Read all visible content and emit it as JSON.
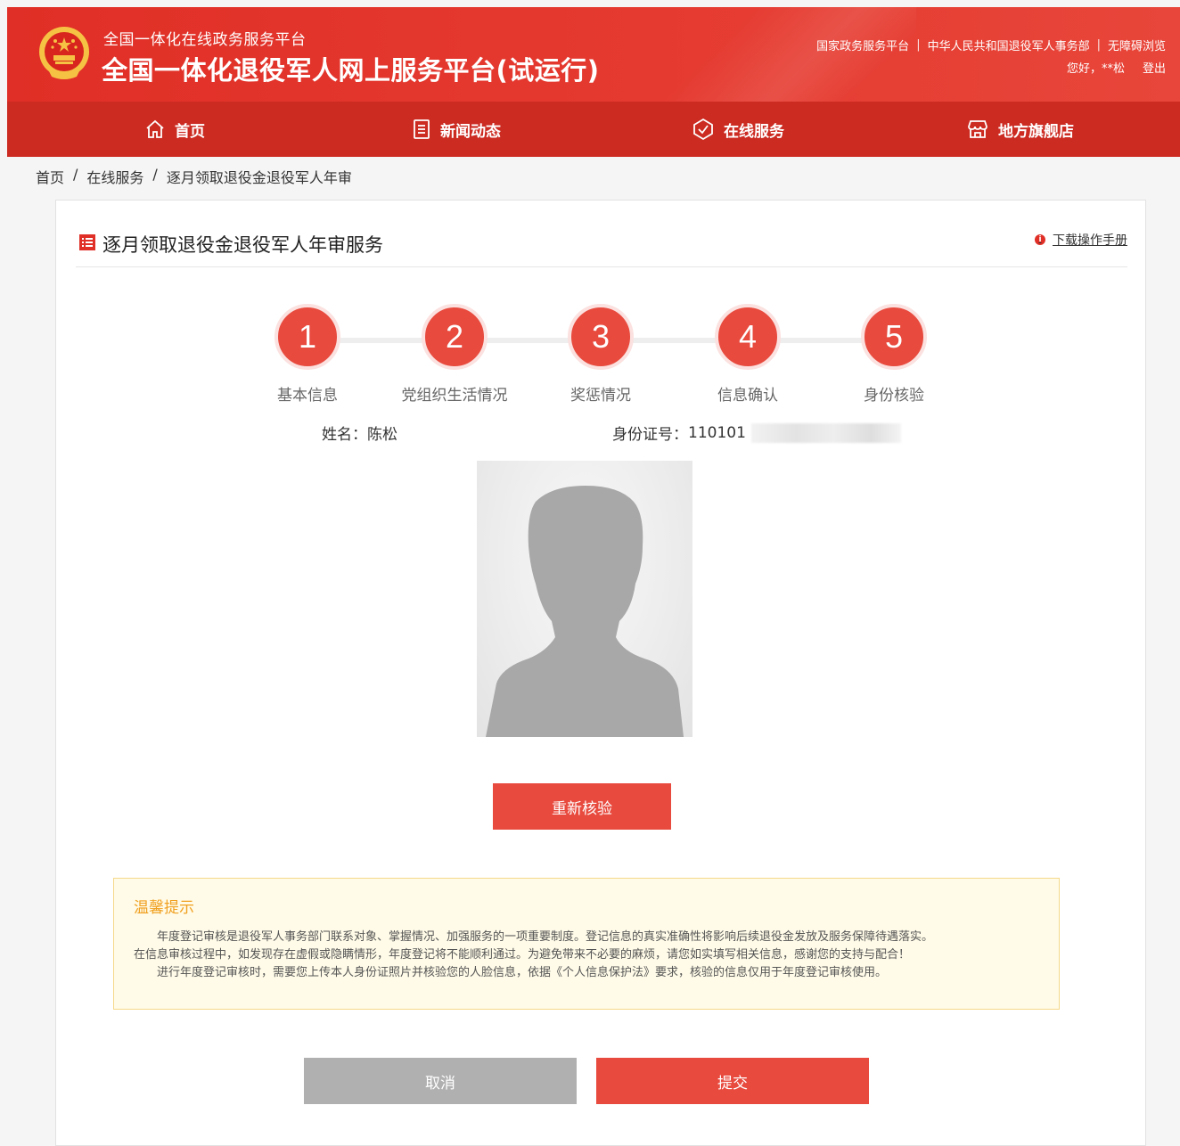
{
  "header": {
    "subtitle": "全国一体化在线政务服务平台",
    "title": "全国一体化退役军人网上服务平台(试运行)",
    "links": [
      "国家政务服务平台",
      "中华人民共和国退役军人事务部",
      "无障碍浏览"
    ],
    "separator": "|",
    "greeting": "您好，**松",
    "logout": "登出"
  },
  "nav": {
    "items": [
      {
        "label": "首页",
        "icon": "home-icon"
      },
      {
        "label": "新闻动态",
        "icon": "news-icon"
      },
      {
        "label": "在线服务",
        "icon": "service-icon"
      },
      {
        "label": "地方旗舰店",
        "icon": "store-icon"
      }
    ]
  },
  "breadcrumb": {
    "items": [
      "首页",
      "在线服务",
      "逐月领取退役金退役军人年审"
    ],
    "separator": "/"
  },
  "card": {
    "title": "逐月领取退役金退役军人年审服务",
    "title_icon": "list-icon",
    "download": "下载操作手册",
    "download_icon": "info-icon"
  },
  "steps": [
    {
      "number": "1",
      "label": "基本信息"
    },
    {
      "number": "2",
      "label": "党组织生活情况"
    },
    {
      "number": "3",
      "label": "奖惩情况"
    },
    {
      "number": "4",
      "label": "信息确认"
    },
    {
      "number": "5",
      "label": "身份核验"
    }
  ],
  "person": {
    "name_label": "姓名：",
    "name": "陈松",
    "id_label": "身份证号：",
    "id_visible": "110101"
  },
  "photo": {
    "icon": "avatar-placeholder-icon"
  },
  "recheck_button": "重新核验",
  "tips": {
    "title": "温馨提示",
    "line1": "年度登记审核是退役军人事务部门联系对象、掌握情况、加强服务的一项重要制度。登记信息的真实准确性将影响后续退役金发放及服务保障待遇落实。",
    "line2": "在信息审核过程中，如发现存在虚假或隐瞒情形，年度登记将不能顺利通过。为避免带来不必要的麻烦，请您如实填写相关信息，感谢您的支持与配合！",
    "line3": "进行年度登记审核时，需要您上传本人身份证照片并核验您的人脸信息，依据《个人信息保护法》要求，核验的信息仅用于年度登记审核使用。"
  },
  "buttons": {
    "cancel": "取消",
    "submit": "提交"
  },
  "colors": {
    "brand_red": "#e02f26",
    "nav_red": "#cc2b22",
    "step_red": "#e84a3e",
    "tips_title": "#f0a020",
    "cancel_gray": "#b0b0b0"
  }
}
